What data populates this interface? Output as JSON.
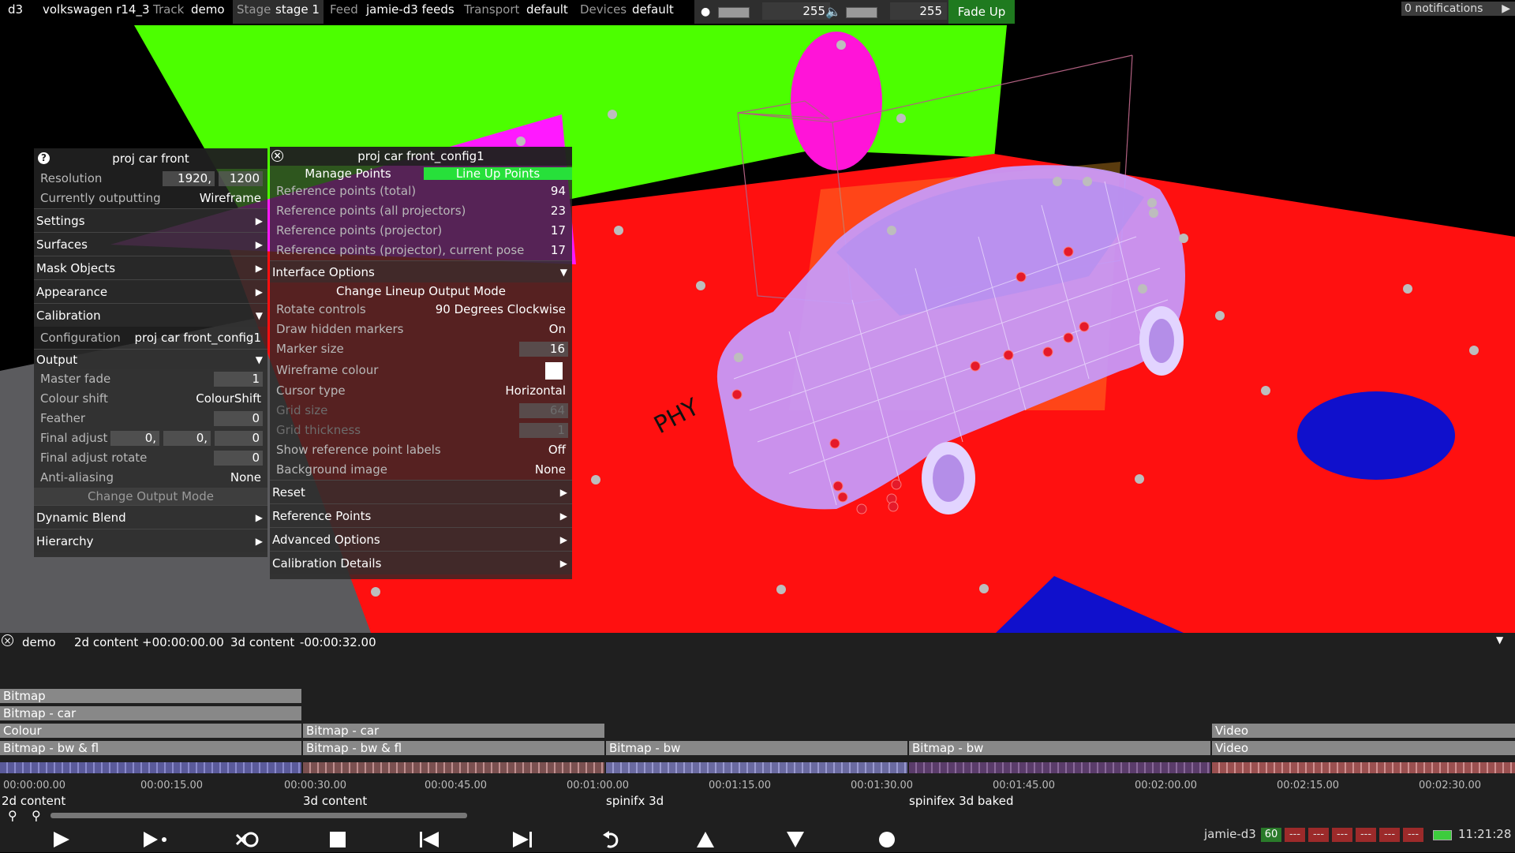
{
  "topbar": {
    "app": "d3",
    "project": "volkswagen r14_3",
    "track_label": "Track",
    "track_value": "demo",
    "stage_label": "Stage",
    "stage_value": "stage 1",
    "feed_label": "Feed",
    "feed_value": "jamie-d3 feeds",
    "transport_label": "Transport",
    "transport_value": "default",
    "devices_label": "Devices",
    "devices_value": "default",
    "brightness_value": "255",
    "volume_value": "255",
    "fade_label": "Fade Up",
    "notifications": "0 notifications"
  },
  "scene": {
    "floor_text": "PHY"
  },
  "panel_left": {
    "title": "proj car front",
    "resolution_label": "Resolution",
    "resolution_w": "1920,",
    "resolution_h": "1200",
    "outputting_label": "Currently outputting",
    "outputting_value": "Wireframe",
    "sections_top": [
      "Settings",
      "Surfaces",
      "Mask Objects",
      "Appearance",
      "Calibration"
    ],
    "config_label": "Configuration",
    "config_value": "proj car front_config1",
    "output_label": "Output",
    "master_fade_label": "Master fade",
    "master_fade_value": "1",
    "colour_shift_label": "Colour shift",
    "colour_shift_value": "ColourShift",
    "feather_label": "Feather",
    "feather_value": "0",
    "final_adjust_label": "Final adjust",
    "final_adjust_values": [
      "0,",
      "0,",
      "0"
    ],
    "final_rotate_label": "Final adjust rotate",
    "final_rotate_value": "0",
    "anti_alias_label": "Anti-aliasing",
    "anti_alias_value": "None",
    "change_mode": "Change Output Mode",
    "dynamic_blend": "Dynamic Blend",
    "hierarchy": "Hierarchy"
  },
  "panel_right": {
    "title": "proj car front_config1",
    "tab_manage": "Manage Points",
    "tab_lineup": "Line Up Points",
    "rows": [
      {
        "k": "Reference points (total)",
        "v": "94"
      },
      {
        "k": "Reference points (all projectors)",
        "v": "23"
      },
      {
        "k": "Reference points (projector)",
        "v": "17"
      },
      {
        "k": "Reference points (projector), current pose",
        "v": "17"
      }
    ],
    "interface_label": "Interface Options",
    "change_lineup": "Change Lineup Output Mode",
    "rotate_label": "Rotate controls",
    "rotate_value": "90 Degrees Clockwise",
    "hidden_label": "Draw hidden markers",
    "hidden_value": "On",
    "marker_label": "Marker size",
    "marker_value": "16",
    "wire_label": "Wireframe colour",
    "cursor_label": "Cursor type",
    "cursor_value": "Horizontal",
    "grid_size_label": "Grid size",
    "grid_size_value": "64",
    "grid_thick_label": "Grid thickness",
    "grid_thick_value": "1",
    "show_labels_label": "Show reference point labels",
    "show_labels_value": "Off",
    "bg_label": "Background image",
    "bg_value": "None",
    "sections_bottom": [
      "Reset",
      "Reference Points",
      "Advanced Options",
      "Calibration Details"
    ]
  },
  "timeline": {
    "track_name": "demo",
    "sec1_name": "2d content",
    "sec1_time": "+00:00:00.00",
    "sec2_name": "3d content",
    "sec2_time": "-00:00:32.00",
    "layers_a": [
      "Bitmap",
      "Bitmap - car",
      "Colour",
      "Bitmap - bw & fl"
    ],
    "layers_b": [
      "Bitmap - car",
      "Bitmap - bw & fl"
    ],
    "layer_c": "Bitmap - bw",
    "layer_d": "Bitmap - bw",
    "layers_e": [
      "Video",
      "Video"
    ],
    "ticks": [
      "00:00:00.00",
      "00:00:15.00",
      "00:00:30.00",
      "00:00:45.00",
      "00:01:00.00",
      "00:01:15.00",
      "00:01:30.00",
      "00:01:45.00",
      "00:02:00.00",
      "00:02:15.00",
      "00:02:30.00"
    ],
    "sections": [
      "2d content",
      "3d content",
      "spinifx 3d",
      "spinifex 3d baked"
    ]
  },
  "status": {
    "machine": "jamie-d3",
    "fps": "60",
    "slots": [
      "---",
      "---",
      "---",
      "---",
      "---",
      "---"
    ],
    "time": "11:21:28"
  }
}
